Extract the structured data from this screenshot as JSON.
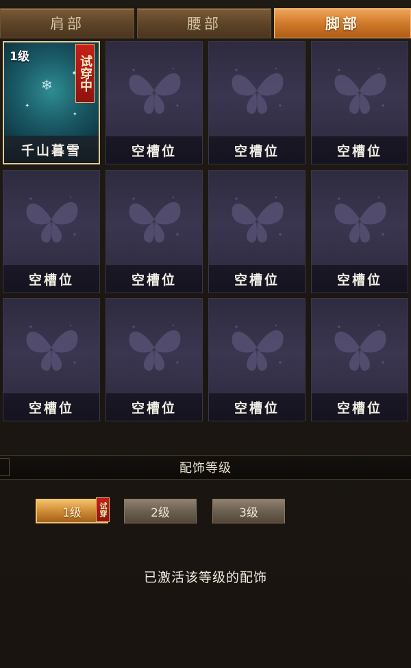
{
  "tabs": [
    {
      "label": "肩部",
      "active": false
    },
    {
      "label": "腰部",
      "active": false
    },
    {
      "label": "脚部",
      "active": true
    }
  ],
  "equipped_slot": {
    "level": "1级",
    "trial_tag": "试穿中",
    "name": "千山暮雪",
    "icon": "snowflake-icon"
  },
  "empty_slots": [
    "空槽位",
    "空槽位",
    "空槽位",
    "空槽位",
    "空槽位",
    "空槽位",
    "空槽位",
    "空槽位",
    "空槽位",
    "空槽位",
    "空槽位"
  ],
  "section": {
    "title": "配饰等级"
  },
  "levels": [
    {
      "label": "1级",
      "active": true,
      "tag": "试穿"
    },
    {
      "label": "2级",
      "active": false
    },
    {
      "label": "3级",
      "active": false
    }
  ],
  "status_text": "已激活该等级的配饰",
  "colors": {
    "accent_orange": "#d07a2c",
    "trial_red": "#c52018",
    "slot_purple": "#3a3650"
  }
}
